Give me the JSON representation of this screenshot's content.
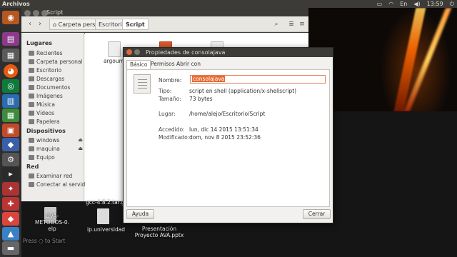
{
  "top_panel": {
    "app_title": "Archivos",
    "clock": "13:59"
  },
  "files_window": {
    "breadcrumbs": [
      "Carpeta personal",
      "Escritorio",
      "Script"
    ],
    "sidebar": {
      "sections": [
        {
          "title": "Lugares",
          "items": [
            "Recientes",
            "Carpeta personal",
            "Escritorio",
            "Descargas",
            "Documentos",
            "Imágenes",
            "Música",
            "Vídeos",
            "Papelera"
          ]
        },
        {
          "title": "Dispositivos",
          "items": [
            "windows",
            "maquina",
            "Equipo"
          ]
        },
        {
          "title": "Red",
          "items": [
            "Examinar red",
            "Conectar al servidor"
          ]
        }
      ]
    },
    "file_label": "argoum",
    "window_title": "Script"
  },
  "desktop_files": [
    "OVA-METODOS-0.\nelp",
    "ip.universidad",
    "Presentación\nProyecto AVA.pptx",
    "gcc-4.8.2.tar.gz"
  ],
  "press_hint": "Press ○ to Start",
  "dialog": {
    "title": "Propiedades de consolajava",
    "tabs": [
      "Básico",
      "Permisos",
      "Abrir con"
    ],
    "name_label": "Nombre:",
    "name_value": "consolajava",
    "type_label": "Tipo:",
    "type_value": "script en shell (application/x-shellscript)",
    "size_label": "Tamaño:",
    "size_value": "73 bytes",
    "location_label": "Lugar:",
    "location_value": "/home/alejo/Escritorio/Script",
    "accessed_label": "Accedido:",
    "accessed_value": "lun, dic 14 2015 13:51:34",
    "modified_label": "Modificado:",
    "modified_value": "dom, nov 8 2015 23:52:36",
    "help_button": "Ayuda",
    "close_button": "Cerrar"
  },
  "colors": {
    "accent": "#e66b35",
    "panel": "#3c3b37"
  }
}
